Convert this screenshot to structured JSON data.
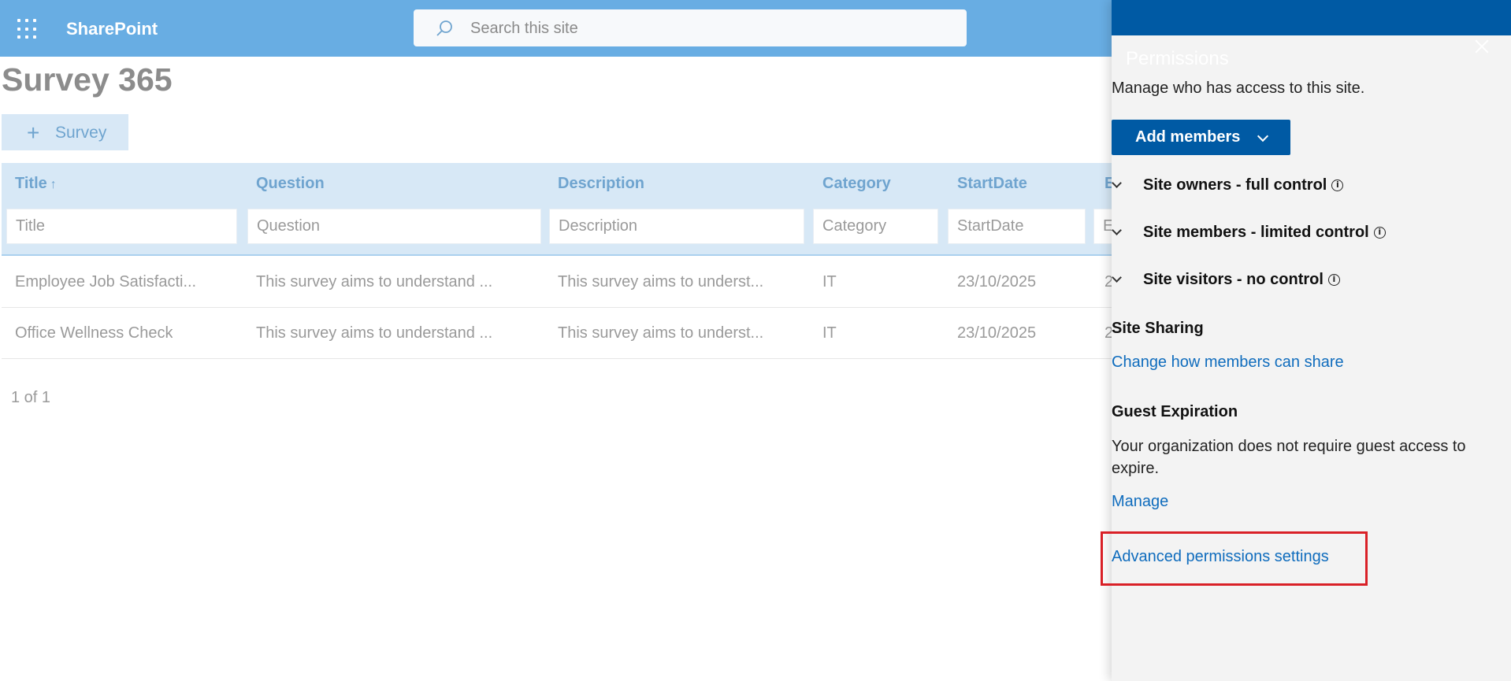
{
  "app": {
    "brand": "SharePoint",
    "search_placeholder": "Search this site",
    "colors": {
      "suite_bar": "#68ade3",
      "panel_header": "#005aa4",
      "link": "#0f6cbd",
      "highlight": "#d92027"
    }
  },
  "page": {
    "title": "Survey 365",
    "new_button": {
      "icon": "plus-icon",
      "label": "Survey"
    }
  },
  "grid": {
    "columns": [
      {
        "label": "Title",
        "sort": "↑",
        "filter_placeholder": "Title"
      },
      {
        "label": "Question",
        "filter_placeholder": "Question"
      },
      {
        "label": "Description",
        "filter_placeholder": "Description"
      },
      {
        "label": "Category",
        "filter_placeholder": "Category"
      },
      {
        "label": "StartDate",
        "filter_placeholder": "StartDate"
      },
      {
        "label": "E",
        "filter_placeholder": "E"
      }
    ],
    "rows": [
      {
        "title": "Employee Job Satisfacti...",
        "question": "This survey aims to understand ...",
        "description": "This survey aims to underst...",
        "category": "IT",
        "start_date": "23/10/2025",
        "end": "2"
      },
      {
        "title": "Office Wellness Check",
        "question": "This survey aims to understand ...",
        "description": "This survey aims to underst...",
        "category": "IT",
        "start_date": "23/10/2025",
        "end": "2"
      }
    ],
    "pager": "1 of 1"
  },
  "panel": {
    "title": "Permissions",
    "description": "Manage who has access to this site.",
    "add_members_label": "Add members",
    "groups": [
      {
        "label": "Site owners - full control",
        "info": "i"
      },
      {
        "label": "Site members - limited control",
        "info": "i"
      },
      {
        "label": "Site visitors - no control",
        "info": "i"
      }
    ],
    "site_sharing": {
      "heading": "Site Sharing",
      "link": "Change how members can share"
    },
    "guest_expiration": {
      "heading": "Guest Expiration",
      "text": "Your organization does not require guest access to expire.",
      "link": "Manage"
    },
    "advanced_link": "Advanced permissions settings"
  }
}
